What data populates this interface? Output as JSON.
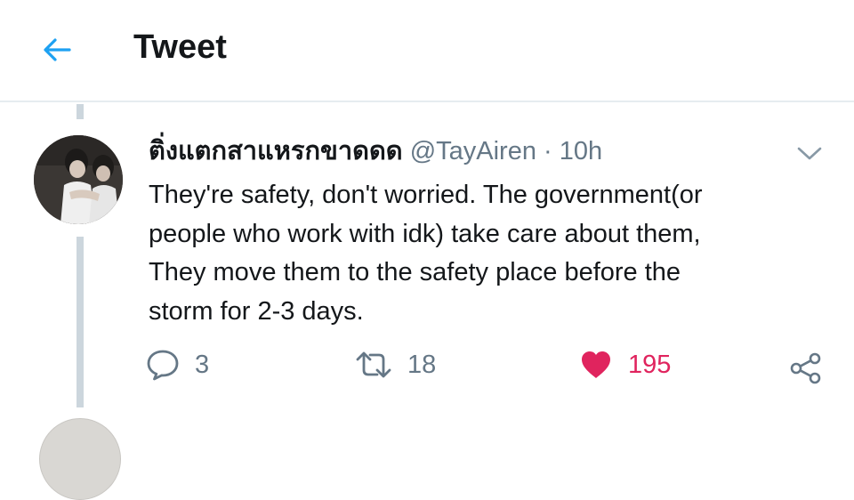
{
  "header": {
    "title": "Tweet",
    "back_icon": "arrow-left-icon",
    "accent": "#1da1f2"
  },
  "tweet": {
    "display_name": "ติ่งแตกสาแหรกขาดดด",
    "handle": "@TayAiren",
    "separator": "·",
    "time": "10h",
    "text_lines": [
      "They're safety, don't worried. The government(or",
      "people who work with idk) take care about them,",
      "They move them to the safety place before the",
      "storm for 2-3 days."
    ],
    "actions": {
      "reply_count": "3",
      "retweet_count": "18",
      "like_count": "195",
      "like_color": "#e0245e"
    }
  }
}
